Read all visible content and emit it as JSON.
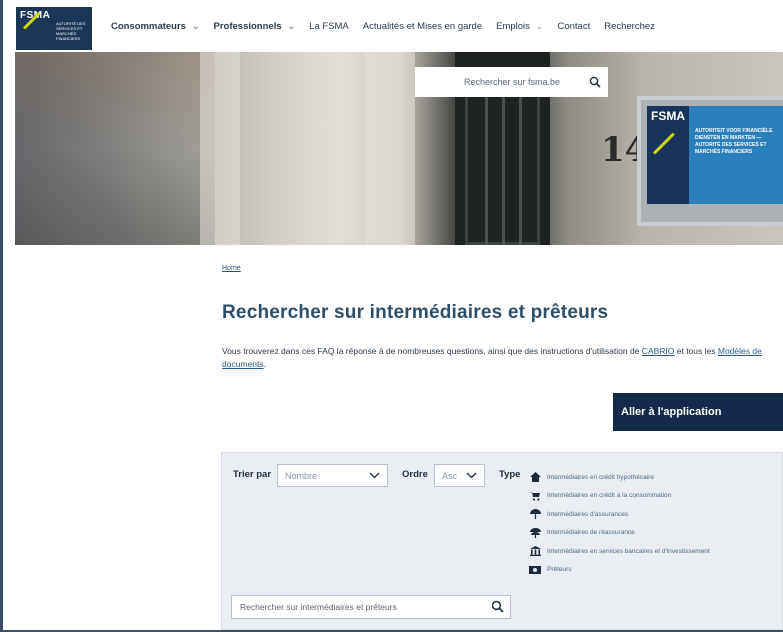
{
  "header": {
    "logo": {
      "word": "FSMA",
      "small_text": "Autorité des services et marchés financiers"
    },
    "nav": [
      {
        "label": "Consommateurs",
        "bold": true,
        "dropdown": true
      },
      {
        "label": "Professionnels",
        "bold": true,
        "dropdown": true
      },
      {
        "label": "La FSMA",
        "bold": false,
        "dropdown": false
      },
      {
        "label": "Actualités et Mises en garde",
        "bold": false,
        "dropdown": false
      },
      {
        "label": "Emplois",
        "bold": false,
        "dropdown": true
      },
      {
        "label": "Contact",
        "bold": false,
        "dropdown": false
      },
      {
        "label": "Recherchez",
        "bold": false,
        "dropdown": false
      }
    ]
  },
  "hero": {
    "search_placeholder": "Rechercher sur fsma.be",
    "house_number": "14",
    "plaque": {
      "word": "FSMA",
      "text": "Autoriteit voor financiële diensten en markten — Autorité des services et marchés financiers"
    }
  },
  "breadcrumb": "Home",
  "page_title": "Rechercher sur intermédiaires et prêteurs",
  "intro": {
    "before": "Vous trouverez dans ces FAQ la réponse à de nombreuses questions, ainsi que des instructions d'utilisation de ",
    "link1": "CABRIO",
    "middle": " et tous les ",
    "link2": "Modèles de documents",
    "after": "."
  },
  "cta_label": "Aller à l'application",
  "filters": {
    "sort_label": "Trier par",
    "sort_value": "Nombre",
    "order_label": "Ordre",
    "order_value": "Asc",
    "type_label": "Type",
    "types": [
      {
        "label": "Intermédiaires en crédit hypothécaire",
        "icon": "house-icon"
      },
      {
        "label": "Intermédiaires en crédit à la consommation",
        "icon": "cart-icon"
      },
      {
        "label": "Intermédiaires d'assurances",
        "icon": "umbrella-icon"
      },
      {
        "label": "Intermédiaires de réassurance",
        "icon": "umbrella-double-icon"
      },
      {
        "label": "Intermédiaires en services bancaires et d'investissement",
        "icon": "bank-icon"
      },
      {
        "label": "Prêteurs",
        "icon": "banknote-icon"
      }
    ],
    "search_placeholder": "Rechercher sur intermédiaires et prêteurs"
  }
}
